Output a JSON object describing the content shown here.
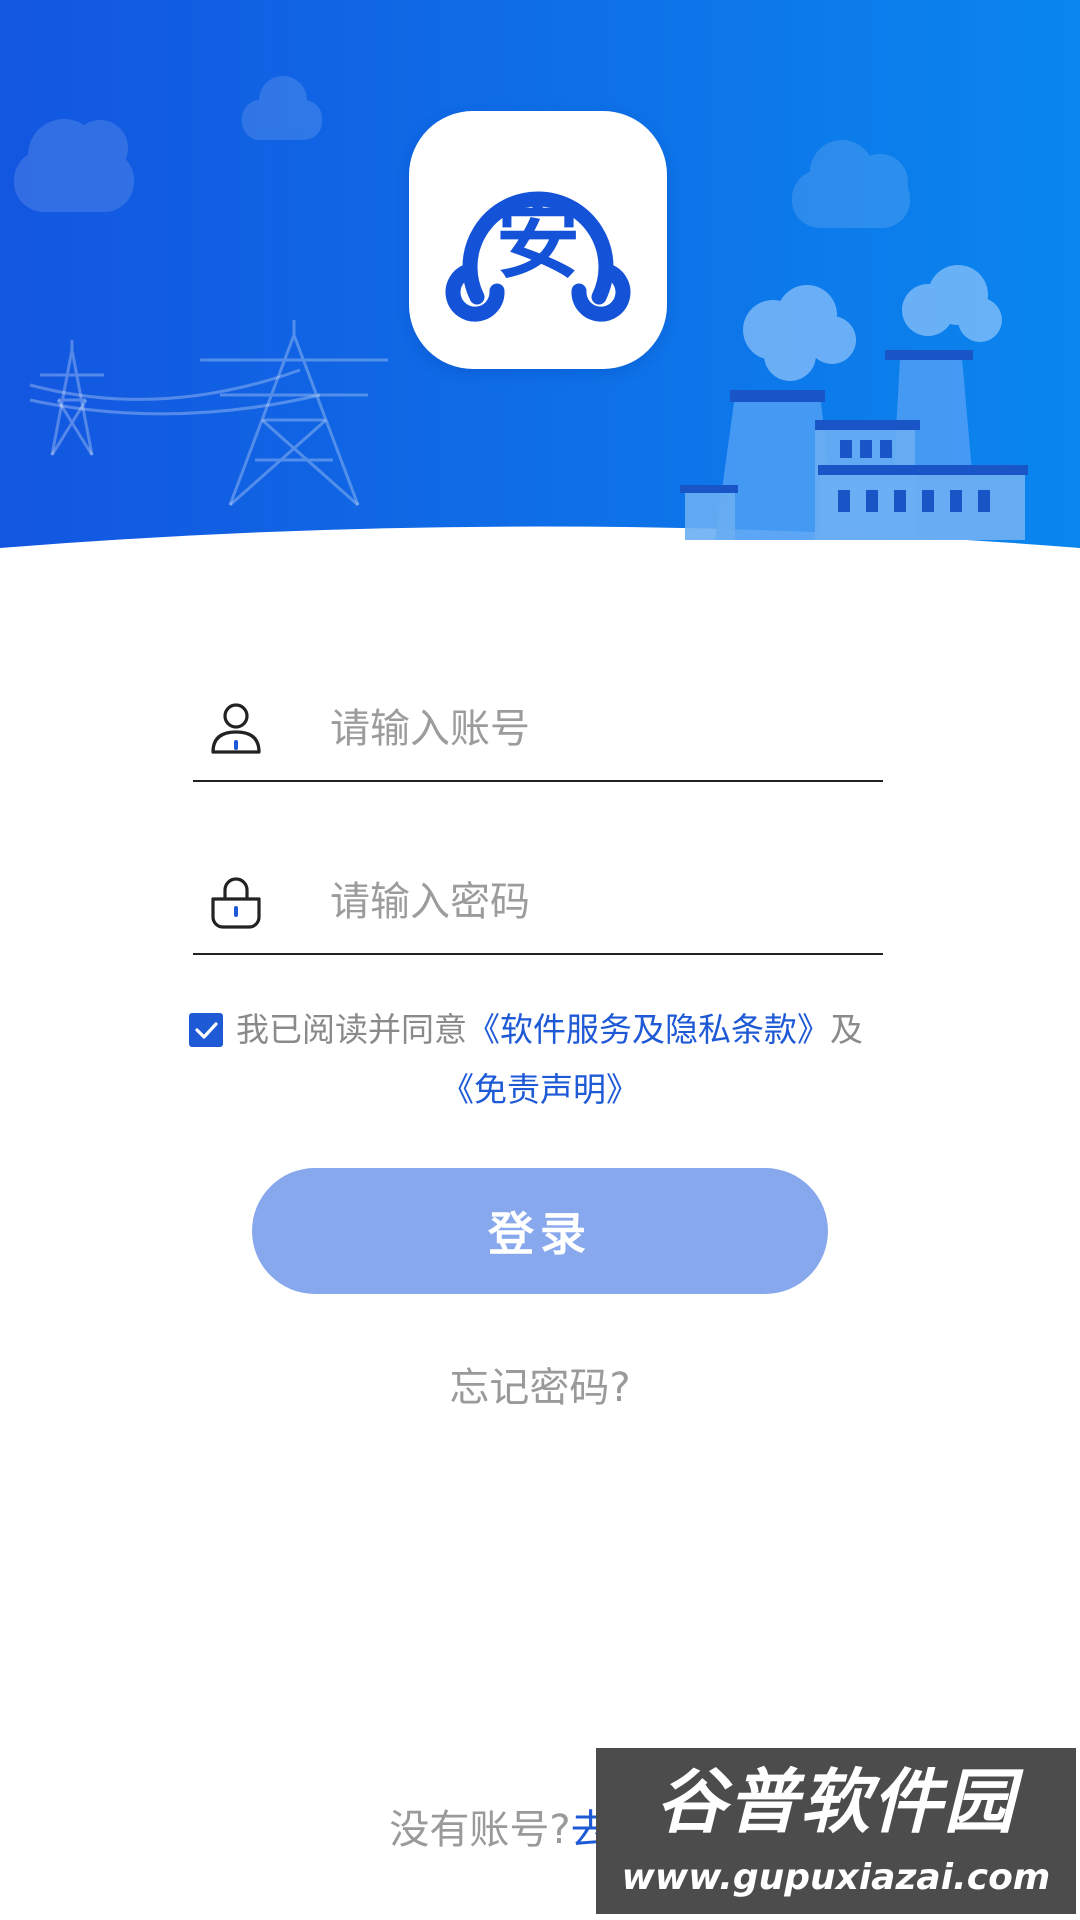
{
  "colors": {
    "brand_blue": "#1e59d6",
    "header_gradient_start": "#1356e0",
    "header_gradient_end": "#0a86ee",
    "button_bg": "#88a8ee",
    "placeholder_gray": "#9c9c9c"
  },
  "logo": {
    "glyph": "安"
  },
  "login_form": {
    "account_placeholder": "请输入账号",
    "password_placeholder": "请输入密码",
    "agreement": {
      "checked": true,
      "prefix": "我已阅读并同意",
      "terms_link": "《软件服务及隐私条款》",
      "conjunction": "及",
      "disclaimer_link": "《免责声明》"
    },
    "login_button": "登录",
    "forgot_password": "忘记密码?"
  },
  "footer": {
    "no_account_text": "没有账号?",
    "register_link": "去注册"
  },
  "watermark": {
    "title": "谷普软件园",
    "url": "www.gupuxiazai.com"
  },
  "icons": {
    "account": "user-icon",
    "password": "lock-icon",
    "checkbox": "checkmark-icon"
  }
}
